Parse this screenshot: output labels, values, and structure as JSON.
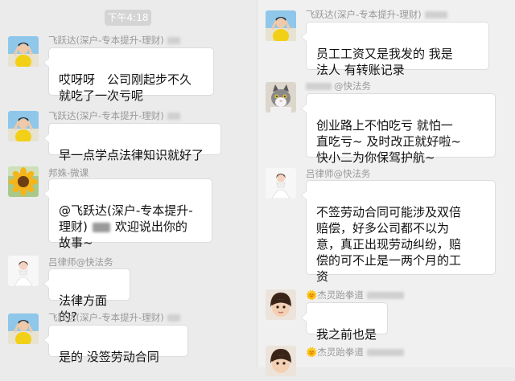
{
  "chat": {
    "timestamp": "下午4:18",
    "left": [
      {
        "sender": "飞跃达(深户-专本提升-理财)",
        "avatar": "woman-yellow-shirt-avatar",
        "lines": [
          "哎呀呀　公司刚起步不久",
          "就吃了一次亏呢"
        ]
      },
      {
        "sender": "飞跃达(深户-专本提升-理财)",
        "avatar": "woman-yellow-shirt-avatar",
        "lines": [
          "早一点学点法律知识就好了"
        ]
      },
      {
        "sender": "邦姝-微课",
        "avatar": "sunflower-avatar",
        "lines": [
          "@飞跃达(深户-专本提升-",
          "理财)",
          "欢迎说出你的",
          "故事~"
        ]
      },
      {
        "sender": "吕律师@快法务",
        "avatar": "bride-avatar",
        "lines": [
          "法律方面的?"
        ]
      },
      {
        "sender": "飞跃达(深户-专本提升-理财)",
        "avatar": "woman-yellow-shirt-avatar",
        "lines": [
          "是的 没签劳动合同"
        ]
      }
    ],
    "right": [
      {
        "sender": "飞跃达(深户-专本提升-理财)",
        "avatar": "woman-yellow-shirt-avatar",
        "lines": [
          "员工工资又是我发的  我是",
          "法人  有转账记录"
        ]
      },
      {
        "sender": "@快法务",
        "avatar": "cat-avatar",
        "lines": [
          "创业路上不怕吃亏 就怕一",
          "直吃亏~ 及时改正就好啦~",
          "快小二为你保驾护航~"
        ]
      },
      {
        "sender": "吕律师@快法务",
        "avatar": "bride-avatar",
        "lines": [
          "不签劳动合同可能涉及双倍",
          "赔偿，好多公司都不以为",
          "意，真正出现劳动纠纷，赔",
          "偿的可不止是一两个月的工",
          "资"
        ]
      },
      {
        "sender": "杰灵跆拳道",
        "avatar": "child-avatar",
        "lines": [
          "我之前也是"
        ]
      },
      {
        "sender": "杰灵跆拳道",
        "avatar": "child-avatar",
        "lines": []
      }
    ]
  },
  "colors": {
    "background": "#ebebeb",
    "bubble": "#ffffff",
    "sender_text": "#999999",
    "timestamp_bg": "#d4d4d4"
  }
}
